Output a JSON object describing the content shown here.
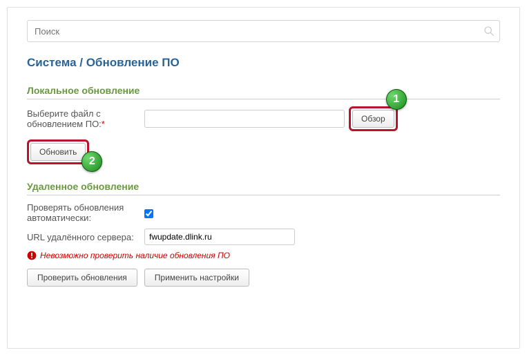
{
  "search": {
    "placeholder": "Поиск"
  },
  "breadcrumb": "Система /  Обновление ПО",
  "local": {
    "title": "Локальное обновление",
    "file_label": "Выберите файл с обновлением ПО:",
    "required": "*",
    "browse_label": "Обзор",
    "update_label": "Обновить",
    "marker1": "1",
    "marker2": "2"
  },
  "remote": {
    "title": "Удаленное обновление",
    "auto_label": "Проверять обновления автоматически:",
    "auto_checked": true,
    "url_label": "URL удалённого сервера:",
    "url_value": "fwupdate.dlink.ru",
    "error_text": "Невозможно проверить наличие обновления ПО",
    "check_label": "Проверить обновления",
    "apply_label": "Применить настройки"
  }
}
